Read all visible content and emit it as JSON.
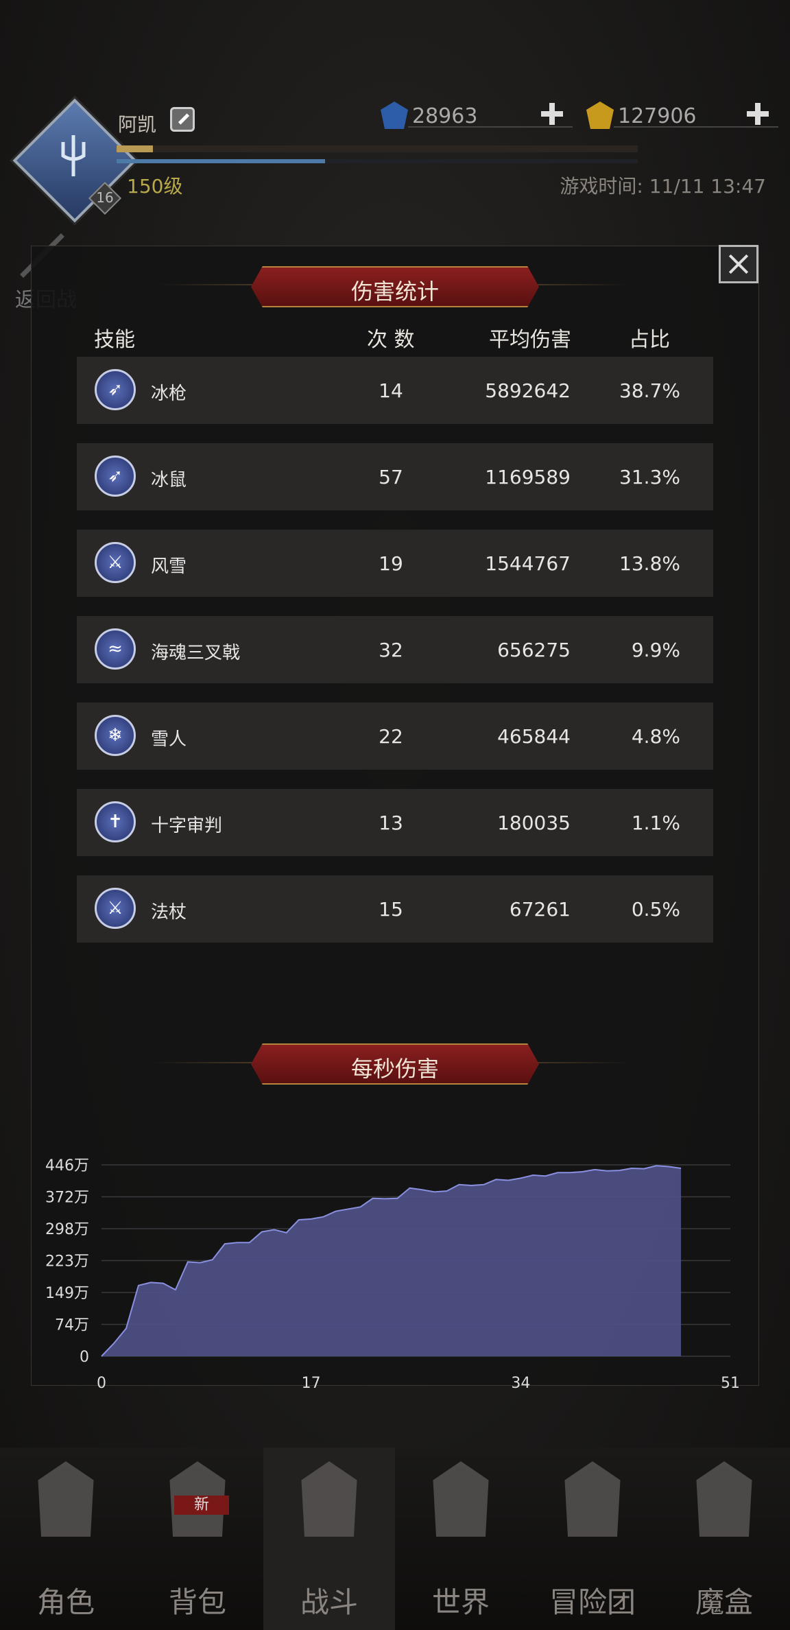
{
  "player": {
    "name": "阿凯",
    "level": "150级",
    "badge_level": "16",
    "exp_progress": 0.07,
    "hp_progress": 0.4
  },
  "resources": {
    "gems": "28963",
    "gold": "127906"
  },
  "game_time": "游戏时间: 11/11 13:47",
  "back_label": "返回战",
  "damage_panel": {
    "title": "伤害统计",
    "columns": {
      "skill": "技能",
      "count": "次 数",
      "avg": "平均伤害",
      "pct": "占比"
    },
    "rows": [
      {
        "name": "冰枪",
        "count": "14",
        "avg": "5892642",
        "pct": "38.7%",
        "icon": "ice-spear-icon"
      },
      {
        "name": "冰鼠",
        "count": "57",
        "avg": "1169589",
        "pct": "31.3%",
        "icon": "ice-rat-icon"
      },
      {
        "name": "风雪",
        "count": "19",
        "avg": "1544767",
        "pct": "13.8%",
        "icon": "blizzard-sword-icon"
      },
      {
        "name": "海魂三叉戟",
        "count": "32",
        "avg": "656275",
        "pct": "9.9%",
        "icon": "sea-wave-icon"
      },
      {
        "name": "雪人",
        "count": "22",
        "avg": "465844",
        "pct": "4.8%",
        "icon": "snowflake-icon"
      },
      {
        "name": "十字审判",
        "count": "13",
        "avg": "180035",
        "pct": "1.1%",
        "icon": "cross-banner-icon"
      },
      {
        "name": "法杖",
        "count": "15",
        "avg": "67261",
        "pct": "0.5%",
        "icon": "staff-sword-icon"
      }
    ]
  },
  "dps_panel": {
    "title": "每秒伤害"
  },
  "chart_data": {
    "type": "area",
    "ylabels": [
      "0",
      "74万",
      "149万",
      "223万",
      "298万",
      "372万",
      "446万"
    ],
    "xlabels": [
      "0",
      "17",
      "34",
      "51"
    ],
    "xlim": [
      0,
      51
    ],
    "ylim": [
      0,
      446
    ],
    "x": [
      0,
      1,
      2,
      3,
      4,
      5,
      6,
      7,
      8,
      9,
      10,
      11,
      12,
      13,
      14,
      15,
      16,
      17,
      18,
      19,
      20,
      21,
      22,
      23,
      24,
      25,
      26,
      27,
      28,
      29,
      30,
      31,
      32,
      33,
      34,
      35,
      36,
      37,
      38,
      39,
      40,
      41,
      42,
      43,
      44,
      45,
      46,
      47
    ],
    "values": [
      0,
      30,
      65,
      165,
      172,
      170,
      155,
      220,
      218,
      225,
      262,
      265,
      265,
      290,
      295,
      288,
      318,
      320,
      325,
      338,
      343,
      348,
      368,
      367,
      368,
      392,
      388,
      383,
      385,
      400,
      398,
      400,
      412,
      410,
      415,
      422,
      420,
      428,
      428,
      430,
      435,
      432,
      433,
      438,
      437,
      444,
      442,
      438
    ],
    "color": "#50528a",
    "grid": true
  },
  "nav": [
    {
      "label": "角色",
      "icon": "helmet-icon"
    },
    {
      "label": "背包",
      "icon": "backpack-icon",
      "tag": "新"
    },
    {
      "label": "战斗",
      "icon": "shield-sword-icon"
    },
    {
      "label": "世界",
      "icon": "map-icon"
    },
    {
      "label": "冒险团",
      "icon": "castle-icon"
    },
    {
      "label": "魔盒",
      "icon": "cube-icon"
    }
  ]
}
